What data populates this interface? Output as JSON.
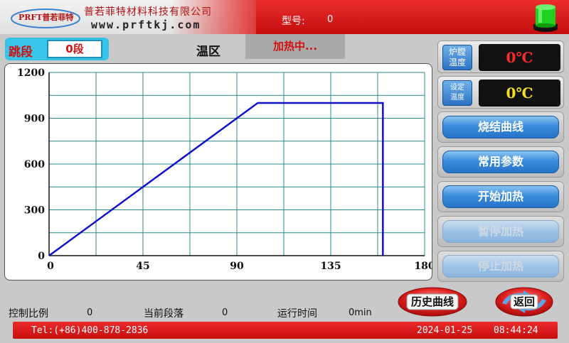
{
  "header": {
    "logo_text": "PRFT普若菲特",
    "company_name": "普若菲特材料科技有限公司",
    "website": "www.prftkj.com",
    "model_label": "型号:",
    "model_value": "0",
    "lamp_color": "#1fd21f"
  },
  "controls": {
    "jump_label": "跳段",
    "jump_value": "0段",
    "zone_label": "温区",
    "status": "加热中..."
  },
  "right_panel": {
    "furnace_temp_icon": "炉膛\n温度",
    "furnace_temp_value": "0℃",
    "furnace_temp_color": "#ff2a2a",
    "set_temp_icon": "设定\n温度",
    "set_temp_value": "0℃",
    "set_temp_color": "#f5e21a",
    "buttons": [
      {
        "label": "烧结曲线",
        "enabled": true
      },
      {
        "label": "常用参数",
        "enabled": true
      },
      {
        "label": "开始加热",
        "enabled": true
      },
      {
        "label": "暂停加热",
        "enabled": false
      },
      {
        "label": "停止加热",
        "enabled": false
      }
    ]
  },
  "bottom": {
    "control_ratio_label": "控制比例",
    "control_ratio_value": "0",
    "current_segment_label": "当前段落",
    "current_segment_value": "0",
    "run_time_label": "运行时间",
    "run_time_value": "0min",
    "history_button": "历史曲线",
    "back_button": "返回"
  },
  "footer": {
    "tel": "Tel:(+86)400-878-2836",
    "date": "2024-01-25",
    "time": "08:44:24"
  },
  "chart_data": {
    "type": "line",
    "x_ticks": [
      0,
      45,
      90,
      135,
      180
    ],
    "y_ticks": [
      0,
      300,
      600,
      900,
      1200
    ],
    "xlim": [
      0,
      180
    ],
    "ylim": [
      0,
      1200
    ],
    "grid": true,
    "x_grid_step": 22.5,
    "y_grid_step": 150,
    "series": [
      {
        "color": "#1111cc",
        "x": [
          0,
          100,
          160,
          160
        ],
        "y": [
          0,
          1000,
          1000,
          0
        ]
      }
    ]
  }
}
